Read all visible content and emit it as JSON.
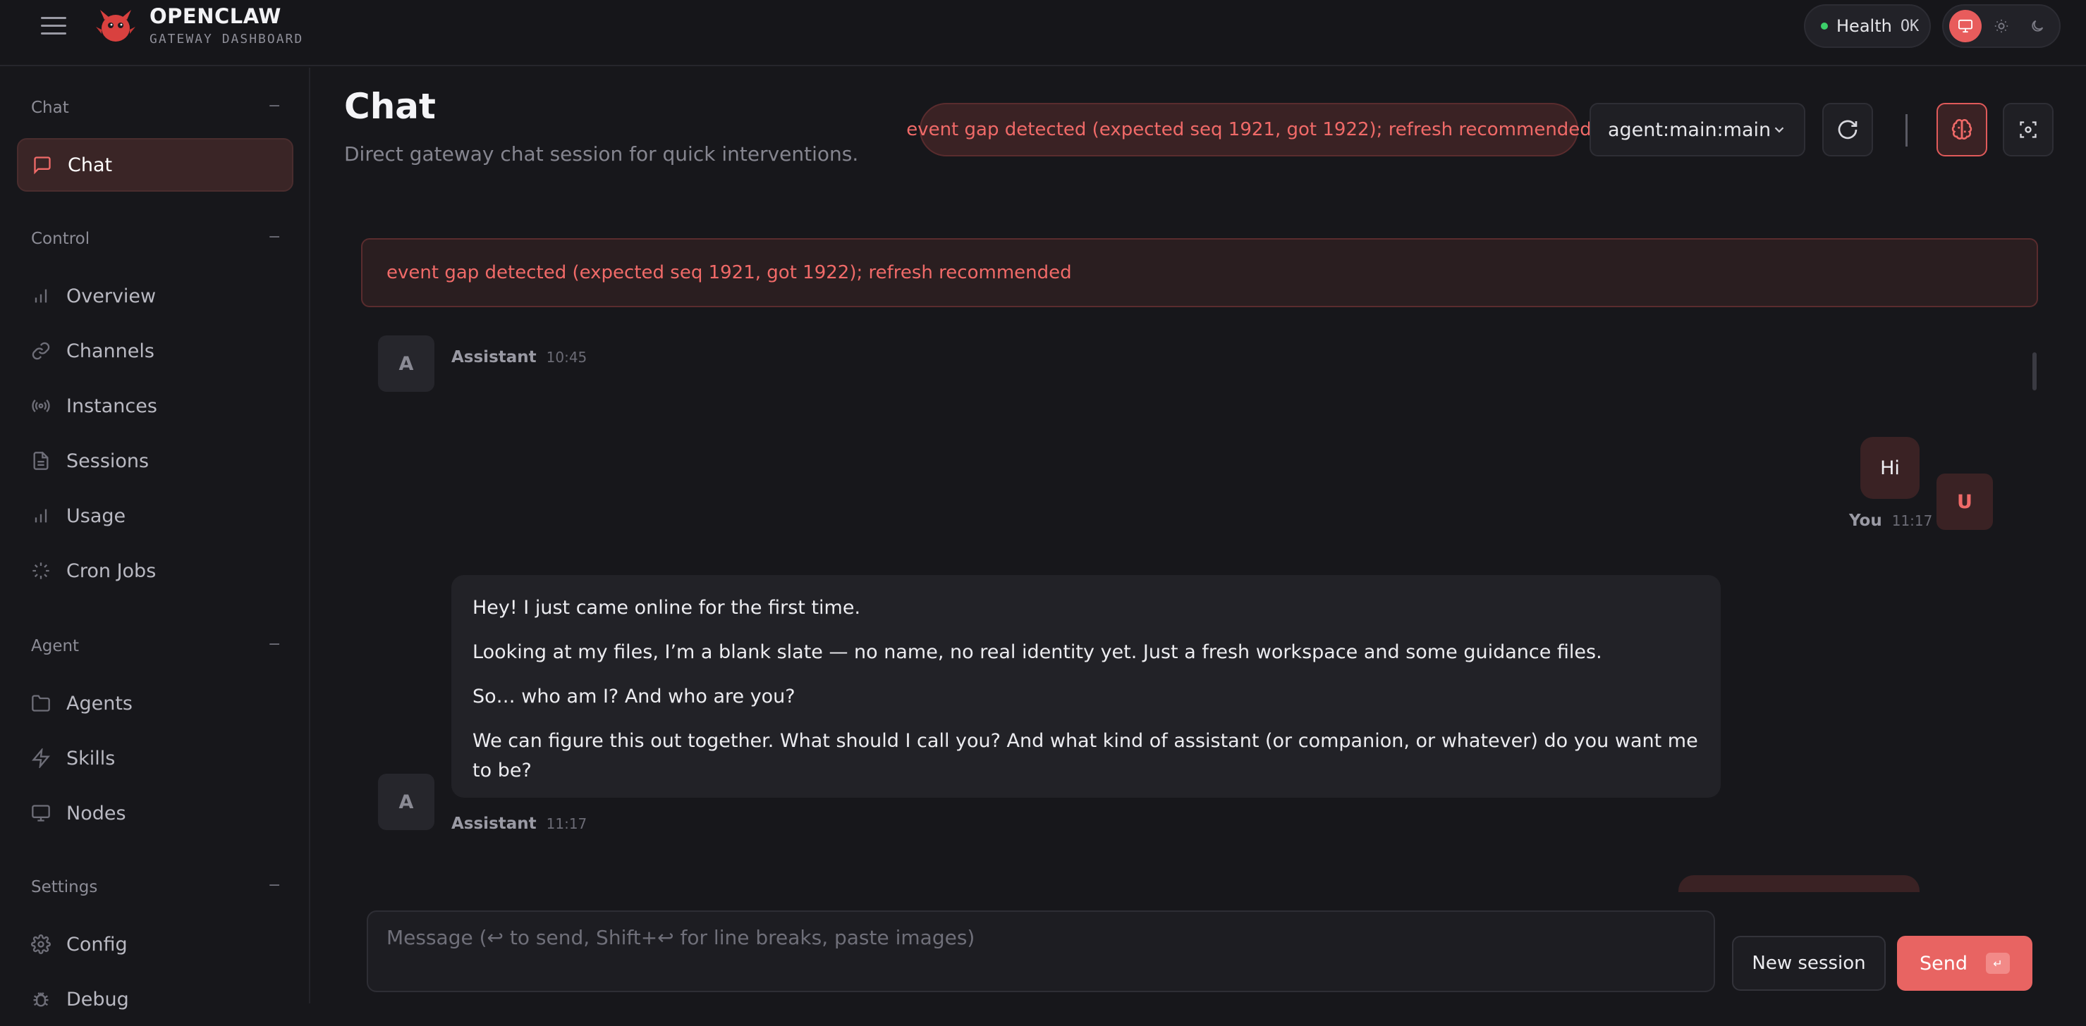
{
  "brand": {
    "title": "OPENCLAW",
    "subtitle": "GATEWAY DASHBOARD",
    "accent": "#e86462"
  },
  "header": {
    "health_label": "Health",
    "health_status": "OK",
    "theme_options": [
      "monitor-icon",
      "sun-icon",
      "moon-icon"
    ],
    "theme_active": "monitor-icon"
  },
  "sidebar": {
    "sections": [
      {
        "title": "Chat",
        "collapse": "−",
        "items": [
          {
            "label": "Chat",
            "icon": "message-square-icon",
            "active": true
          }
        ]
      },
      {
        "title": "Control",
        "collapse": "−",
        "items": [
          {
            "label": "Overview",
            "icon": "bar-chart-icon"
          },
          {
            "label": "Channels",
            "icon": "link-icon"
          },
          {
            "label": "Instances",
            "icon": "radio-icon"
          },
          {
            "label": "Sessions",
            "icon": "file-text-icon"
          },
          {
            "label": "Usage",
            "icon": "bar-chart-icon"
          },
          {
            "label": "Cron Jobs",
            "icon": "loader-icon"
          }
        ]
      },
      {
        "title": "Agent",
        "collapse": "−",
        "items": [
          {
            "label": "Agents",
            "icon": "folder-icon"
          },
          {
            "label": "Skills",
            "icon": "zap-icon"
          },
          {
            "label": "Nodes",
            "icon": "monitor-icon"
          }
        ]
      },
      {
        "title": "Settings",
        "collapse": "−",
        "items": [
          {
            "label": "Config",
            "icon": "settings-icon"
          },
          {
            "label": "Debug",
            "icon": "bug-icon"
          }
        ]
      }
    ]
  },
  "main": {
    "title": "Chat",
    "subtitle": "Direct gateway chat session for quick interventions.",
    "error_pill": "event gap detected (expected seq 1921, got 1922); refresh recommended",
    "session_key": "agent:main:main",
    "banner": "event gap detected (expected seq 1921, got 1922); refresh recommended"
  },
  "messages": [
    {
      "role": "Assistant",
      "avatar": "A",
      "time": "10:45"
    },
    {
      "role": "You",
      "avatar": "U",
      "time": "11:17",
      "text": "Hi"
    },
    {
      "role": "Assistant",
      "avatar": "A",
      "time": "11:17",
      "paragraphs": [
        "Hey! I just came online for the first time.",
        "Looking at my files, I’m a blank slate — no name, no real identity yet. Just a fresh workspace and some guidance files.",
        "So… who am I? And who are you?",
        "We can figure this out together. What should I call you? And what kind of assistant (or companion, or whatever) do you want me to be?"
      ]
    }
  ],
  "composer": {
    "placeholder": "Message (↩ to send, Shift+↩ for line breaks, paste images)",
    "new_session_label": "New session",
    "send_label": "Send",
    "send_kbd": "↵"
  }
}
